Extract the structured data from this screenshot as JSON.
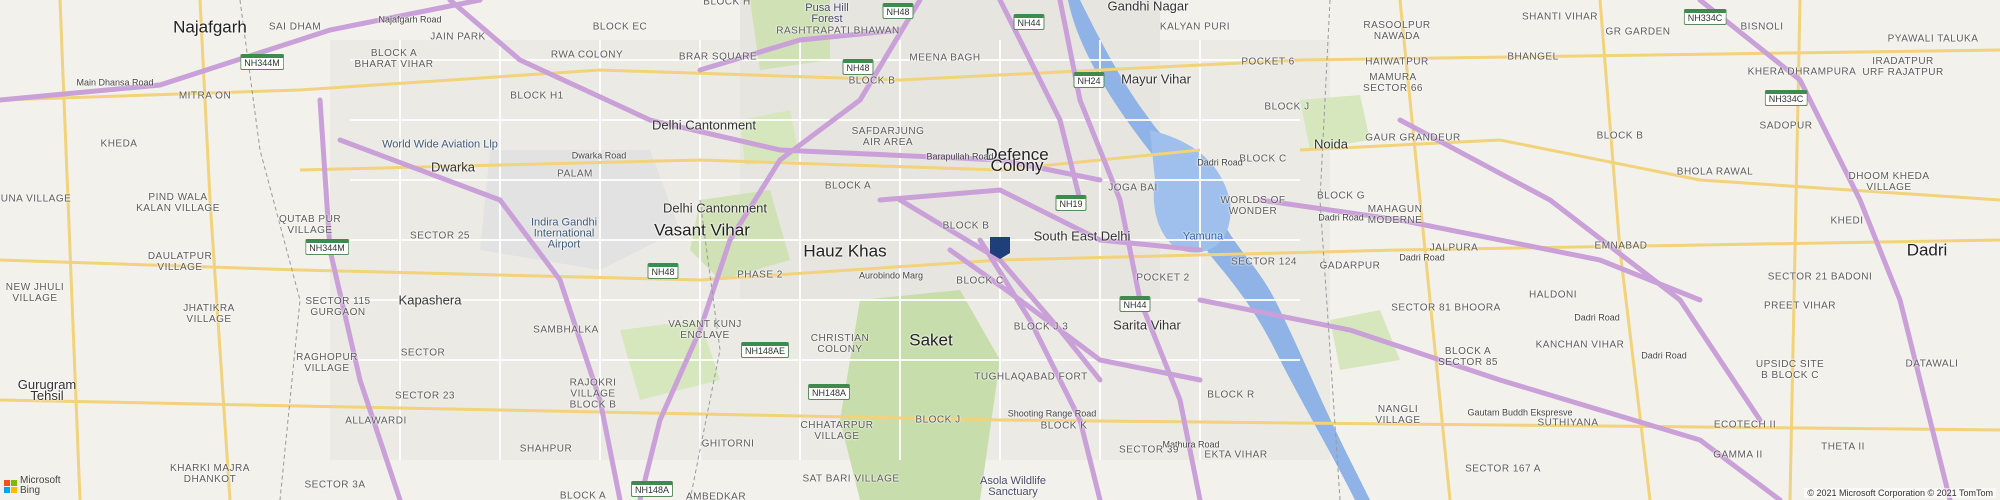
{
  "map": {
    "labels": [
      {
        "id": "najafgarh",
        "text": "Najafgarh",
        "kind": "city"
      },
      {
        "id": "sai-dham",
        "text": "SAI DHAM",
        "kind": "locality"
      },
      {
        "id": "najafgarh-road",
        "text": "Najafgarh Road",
        "kind": "road"
      },
      {
        "id": "block-ec",
        "text": "BLOCK EC",
        "kind": "locality"
      },
      {
        "id": "block-h",
        "text": "BLOCK H",
        "kind": "locality"
      },
      {
        "id": "pusa-hill-forest",
        "text": "Pusa Hill\nForest",
        "kind": "poi"
      },
      {
        "id": "rashtrapati-bhawan",
        "text": "RASHTRAPATI BHAWAN",
        "kind": "locality"
      },
      {
        "id": "gandhi-nagar",
        "text": "Gandhi Nagar",
        "kind": "area"
      },
      {
        "id": "kalyan-puri",
        "text": "KALYAN PURI",
        "kind": "locality"
      },
      {
        "id": "rasoolpur-nawada",
        "text": "RASOOLPUR\nNAWADA",
        "kind": "locality"
      },
      {
        "id": "shanti-vihar",
        "text": "SHANTI VIHAR",
        "kind": "locality"
      },
      {
        "id": "gr-garden",
        "text": "GR GARDEN",
        "kind": "locality"
      },
      {
        "id": "bisnoli",
        "text": "BISNOLI",
        "kind": "locality"
      },
      {
        "id": "block-a-bharat-vihar",
        "text": "BLOCK A\nBHARAT VIHAR",
        "kind": "locality"
      },
      {
        "id": "jain-park",
        "text": "JAIN PARK",
        "kind": "locality"
      },
      {
        "id": "rwa-colony",
        "text": "RWA COLONY",
        "kind": "locality"
      },
      {
        "id": "brar-square",
        "text": "BRAR SQUARE",
        "kind": "locality"
      },
      {
        "id": "meena-bagh",
        "text": "MEENA BAGH",
        "kind": "locality"
      },
      {
        "id": "pocket-6",
        "text": "POCKET 6",
        "kind": "locality"
      },
      {
        "id": "haiwatpur",
        "text": "HAIWATPUR",
        "kind": "locality"
      },
      {
        "id": "bhangel",
        "text": "BHANGEL",
        "kind": "locality"
      },
      {
        "id": "pyawali-taluka",
        "text": "PYAWALI TALUKA",
        "kind": "locality"
      },
      {
        "id": "main-dhansa-road",
        "text": "Main Dhansa Road",
        "kind": "road"
      },
      {
        "id": "mitra-on",
        "text": "MITRA ON",
        "kind": "locality"
      },
      {
        "id": "block-h1",
        "text": "BLOCK H1",
        "kind": "locality"
      },
      {
        "id": "block-b-north",
        "text": "BLOCK B",
        "kind": "locality"
      },
      {
        "id": "mayur-vihar",
        "text": "Mayur Vihar",
        "kind": "area"
      },
      {
        "id": "mamura-sector-66",
        "text": "MAMURA\nSECTOR 66",
        "kind": "locality"
      },
      {
        "id": "khera-dhrampura",
        "text": "KHERA DHRAMPURA",
        "kind": "locality"
      },
      {
        "id": "iradatpur-urf-rajatpur",
        "text": "IRADATPUR\nURF RAJATPUR",
        "kind": "locality"
      },
      {
        "id": "delhi-cantonment-1",
        "text": "Delhi Cantonment",
        "kind": "area"
      },
      {
        "id": "safdarjung-air-area",
        "text": "SAFDARJUNG\nAIR AREA",
        "kind": "locality"
      },
      {
        "id": "defence-colony",
        "text": "Defence\nColony",
        "kind": "city"
      },
      {
        "id": "block-j-noida",
        "text": "BLOCK J",
        "kind": "locality"
      },
      {
        "id": "sadopur",
        "text": "SADOPUR",
        "kind": "locality"
      },
      {
        "id": "kheda",
        "text": "KHEDA",
        "kind": "locality"
      },
      {
        "id": "world-wide-aviation",
        "text": "World Wide Aviation Llp",
        "kind": "airport"
      },
      {
        "id": "noida",
        "text": "Noida",
        "kind": "area"
      },
      {
        "id": "gaur-grandeur",
        "text": "GAUR GRANDEUR",
        "kind": "locality"
      },
      {
        "id": "block-b-noida",
        "text": "BLOCK B",
        "kind": "locality"
      },
      {
        "id": "dwarka",
        "text": "Dwarka",
        "kind": "area"
      },
      {
        "id": "dwarka-road",
        "text": "Dwarka Road",
        "kind": "road"
      },
      {
        "id": "palam",
        "text": "PALAM",
        "kind": "locality"
      },
      {
        "id": "barapullah-road",
        "text": "Barapullah Road",
        "kind": "road"
      },
      {
        "id": "block-c-noida",
        "text": "BLOCK C",
        "kind": "locality"
      },
      {
        "id": "dadri-road-1",
        "text": "Dadri Road",
        "kind": "road"
      },
      {
        "id": "bhola-rawal",
        "text": "BHOLA RAWAL",
        "kind": "locality"
      },
      {
        "id": "dhoom-kheda-village",
        "text": "DHOOM KHEDA\nVILLAGE",
        "kind": "locality"
      },
      {
        "id": "pind-wala-kalan",
        "text": "PIND WALA\nKALAN VILLAGE",
        "kind": "locality"
      },
      {
        "id": "block-a-vasant",
        "text": "BLOCK A",
        "kind": "locality"
      },
      {
        "id": "joga-bai",
        "text": "JOGA BAI",
        "kind": "locality"
      },
      {
        "id": "worlds-of-wonder",
        "text": "WORLDS OF\nWONDER",
        "kind": "locality"
      },
      {
        "id": "block-g",
        "text": "BLOCK G",
        "kind": "locality"
      },
      {
        "id": "mahagun-moderne",
        "text": "MAHAGUN\nMODERNE",
        "kind": "locality"
      },
      {
        "id": "khedi",
        "text": "KHEDI",
        "kind": "locality"
      },
      {
        "id": "una-village",
        "text": "UNA VILLAGE",
        "kind": "locality"
      },
      {
        "id": "delhi-cantonment-2",
        "text": "Delhi Cantonment",
        "kind": "area"
      },
      {
        "id": "vasant-vihar",
        "text": "Vasant Vihar",
        "kind": "city"
      },
      {
        "id": "block-b-central",
        "text": "BLOCK B",
        "kind": "locality"
      },
      {
        "id": "south-east-delhi",
        "text": "South East Delhi",
        "kind": "area"
      },
      {
        "id": "yamuna",
        "text": "Yamuna",
        "kind": "water"
      },
      {
        "id": "dadri-road-2",
        "text": "Dadri Road",
        "kind": "road"
      },
      {
        "id": "qutab-pur-village",
        "text": "QUTAB PUR\nVILLAGE",
        "kind": "locality"
      },
      {
        "id": "igi-airport",
        "text": "Indira Gandhi\nInternational\nAirport",
        "kind": "airport"
      },
      {
        "id": "hauz-khas",
        "text": "Hauz Khas",
        "kind": "city"
      },
      {
        "id": "dadri",
        "text": "Dadri",
        "kind": "city"
      },
      {
        "id": "sector-25",
        "text": "SECTOR 25",
        "kind": "locality"
      },
      {
        "id": "daulatpur-village",
        "text": "DAULATPUR\nVILLAGE",
        "kind": "locality"
      },
      {
        "id": "phase-2",
        "text": "PHASE 2",
        "kind": "locality"
      },
      {
        "id": "aurobindo-marg",
        "text": "Aurobindo Marg",
        "kind": "road"
      },
      {
        "id": "block-c-central",
        "text": "BLOCK C",
        "kind": "locality"
      },
      {
        "id": "pocket-2",
        "text": "POCKET 2",
        "kind": "locality"
      },
      {
        "id": "sector-124",
        "text": "SECTOR 124",
        "kind": "locality"
      },
      {
        "id": "gadarpur",
        "text": "GADARPUR",
        "kind": "locality"
      },
      {
        "id": "emnabad",
        "text": "EMNABAD",
        "kind": "locality"
      },
      {
        "id": "jalpura",
        "text": "JALPURA",
        "kind": "locality"
      },
      {
        "id": "dadri-road-3",
        "text": "Dadri Road",
        "kind": "road"
      },
      {
        "id": "haldoni",
        "text": "HALDONI",
        "kind": "locality"
      },
      {
        "id": "sector-21-badoni",
        "text": "SECTOR 21 BADONI",
        "kind": "locality"
      },
      {
        "id": "new-jhuli-village",
        "text": "NEW JHULI\nVILLAGE",
        "kind": "locality"
      },
      {
        "id": "jhatikra-village",
        "text": "JHATIKRA\nVILLAGE",
        "kind": "locality"
      },
      {
        "id": "sector-115-gurgaon",
        "text": "SECTOR 115\nGURGAON",
        "kind": "locality"
      },
      {
        "id": "kapashera",
        "text": "Kapashera",
        "kind": "area"
      },
      {
        "id": "vasant-kunj-enclave",
        "text": "VASANT KUNJ\nENCLAVE",
        "kind": "locality"
      },
      {
        "id": "christian-colony",
        "text": "CHRISTIAN\nCOLONY",
        "kind": "locality"
      },
      {
        "id": "saket",
        "text": "Saket",
        "kind": "city"
      },
      {
        "id": "block-j3",
        "text": "BLOCK J 3",
        "kind": "locality"
      },
      {
        "id": "sarita-vihar",
        "text": "Sarita Vihar",
        "kind": "area"
      },
      {
        "id": "sector-81-bhoora",
        "text": "SECTOR 81 BHOORA",
        "kind": "locality"
      },
      {
        "id": "dadri-road-4",
        "text": "Dadri Road",
        "kind": "road"
      },
      {
        "id": "preet-vihar",
        "text": "PREET VIHAR",
        "kind": "locality"
      },
      {
        "id": "sambhalka",
        "text": "SAMBHALKA",
        "kind": "locality"
      },
      {
        "id": "raghopur-village",
        "text": "RAGHOPUR\nVILLAGE",
        "kind": "locality"
      },
      {
        "id": "sector",
        "text": "SECTOR",
        "kind": "locality"
      },
      {
        "id": "kanchan-vihar",
        "text": "KANCHAN VIHAR",
        "kind": "locality"
      },
      {
        "id": "block-a-sector-85",
        "text": "BLOCK A\nSECTOR 85",
        "kind": "locality"
      },
      {
        "id": "dadri-road-5",
        "text": "Dadri Road",
        "kind": "road"
      },
      {
        "id": "upsidc-site",
        "text": "UPSIDC SITE\nB BLOCK C",
        "kind": "locality"
      },
      {
        "id": "datawali",
        "text": "DATAWALI",
        "kind": "locality"
      },
      {
        "id": "gurugram-tehsil",
        "text": "Gurugram\nTehsil",
        "kind": "area"
      },
      {
        "id": "rajokri-village",
        "text": "RAJOKRI\nVILLAGE\nBLOCK B",
        "kind": "locality"
      },
      {
        "id": "tughlaqabad-fort",
        "text": "TUGHLAQABAD FORT",
        "kind": "locality"
      },
      {
        "id": "sector-23",
        "text": "SECTOR 23",
        "kind": "locality"
      },
      {
        "id": "block-r",
        "text": "BLOCK R",
        "kind": "locality"
      },
      {
        "id": "gautam-buddh-ekspresve",
        "text": "Gautam Buddh Ekspresve",
        "kind": "road"
      },
      {
        "id": "allawardi",
        "text": "ALLAWARDI",
        "kind": "locality"
      },
      {
        "id": "chhatarpur-village",
        "text": "CHHATARPUR\nVILLAGE",
        "kind": "locality"
      },
      {
        "id": "block-j",
        "text": "BLOCK J",
        "kind": "locality"
      },
      {
        "id": "nangli-village",
        "text": "NANGLI\nVILLAGE",
        "kind": "locality"
      },
      {
        "id": "suthiyana",
        "text": "SUTHIYANA",
        "kind": "locality"
      },
      {
        "id": "ecotech-ii",
        "text": "ECOTECH II",
        "kind": "locality"
      },
      {
        "id": "block-k",
        "text": "BLOCK K",
        "kind": "locality"
      },
      {
        "id": "shooting-range-road",
        "text": "Shooting Range Road",
        "kind": "road"
      },
      {
        "id": "mathura-road",
        "text": "Mathura Road",
        "kind": "road"
      },
      {
        "id": "kharki-majra-dhankot",
        "text": "KHARKI MAJRA\nDHANKOT",
        "kind": "locality"
      },
      {
        "id": "shahpur",
        "text": "SHAHPUR",
        "kind": "locality"
      },
      {
        "id": "ghitorni",
        "text": "GHITORNI",
        "kind": "locality"
      },
      {
        "id": "sector-39",
        "text": "SECTOR 39",
        "kind": "locality"
      },
      {
        "id": "ekta-vihar",
        "text": "EKTA VIHAR",
        "kind": "locality"
      },
      {
        "id": "gamma-ii",
        "text": "GAMMA II",
        "kind": "locality"
      },
      {
        "id": "theta-ii",
        "text": "THETA II",
        "kind": "locality"
      },
      {
        "id": "sector-167-a",
        "text": "SECTOR 167 A",
        "kind": "locality"
      },
      {
        "id": "sector-3a",
        "text": "SECTOR 3A",
        "kind": "locality"
      },
      {
        "id": "block-a-south",
        "text": "BLOCK A",
        "kind": "locality"
      },
      {
        "id": "sat-bari-village",
        "text": "SAT BARI VILLAGE",
        "kind": "locality"
      },
      {
        "id": "asola-wildlife",
        "text": "Asola Wildlife\nSanctuary",
        "kind": "poi"
      },
      {
        "id": "ambedkar",
        "text": "AMBEDKAR",
        "kind": "locality"
      }
    ],
    "shields": [
      {
        "id": "nh48-top",
        "text": "NH48"
      },
      {
        "id": "nh44-top",
        "text": "NH44"
      },
      {
        "id": "nh334c-top",
        "text": "NH334C"
      },
      {
        "id": "nh344m-left",
        "text": "NH344M"
      },
      {
        "id": "nh48-mid",
        "text": "NH48"
      },
      {
        "id": "nh24",
        "text": "NH24"
      },
      {
        "id": "nh334c-right",
        "text": "NH334C"
      },
      {
        "id": "nh19",
        "text": "NH19"
      },
      {
        "id": "nh344m-mid",
        "text": "NH344M"
      },
      {
        "id": "nh48-south",
        "text": "NH48"
      },
      {
        "id": "nh44-south",
        "text": "NH44"
      },
      {
        "id": "nh148ae",
        "text": "NH148AE"
      },
      {
        "id": "nh148a",
        "text": "NH148A"
      },
      {
        "id": "nh148a-bottom",
        "text": "NH148A"
      }
    ],
    "marker": {
      "name": "location-marker",
      "color": "#1f3f7a"
    },
    "colors": {
      "land": "#f2f1ec",
      "park": "#cfe1b5",
      "water": "#8fb3e6",
      "highway": "#c9a0d8",
      "road": "#f2d27a",
      "minor": "#ffffff",
      "urban": "#e7e6e1"
    }
  },
  "attribution": {
    "bing_logo_line1": "Microsoft",
    "bing_logo_line2": "Bing",
    "copyright": "© 2021 Microsoft Corporation © 2021 TomTom"
  }
}
